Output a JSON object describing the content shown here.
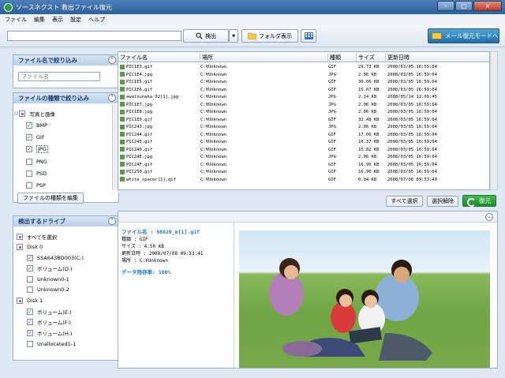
{
  "window": {
    "title": "ソースネクスト 救出ファイル復元",
    "min": "–",
    "max": "□",
    "close": "×"
  },
  "menu": [
    "ファイル",
    "編集",
    "表示",
    "設定",
    "ヘルプ"
  ],
  "toolbar": {
    "search_value": "",
    "search_label": "検出",
    "dropdown": "▼",
    "folder_view_label": "フォルダ表示",
    "mail_mode_label": "メール復元モードへ"
  },
  "filter_name": {
    "title": "ファイル名で絞り込み",
    "placeholder": "ファイル名",
    "toggle": "⌃"
  },
  "filter_type": {
    "title": "ファイルの種類で絞り込み",
    "toggle": "⌃",
    "group_label": "写真と画像",
    "group_expander": "⊟",
    "items": [
      {
        "label": "BMP",
        "checked": true
      },
      {
        "label": "GIF",
        "checked": true
      },
      {
        "label": "JPG",
        "checked": true
      },
      {
        "label": "PNG",
        "checked": false
      },
      {
        "label": "PSD",
        "checked": false
      },
      {
        "label": "PSP",
        "checked": false
      }
    ],
    "edit_button": "ファイルの種類を編集"
  },
  "drives": {
    "title": "検出するドライブ",
    "toggle": "⌃",
    "select_all": "すべてを選択",
    "disks": [
      {
        "label": "Disk 0",
        "volumes": [
          {
            "label": "SSA643BD003(C:)",
            "checked": true
          },
          {
            "label": "ボリューム(D:)",
            "checked": true
          },
          {
            "label": "Unknown0-1",
            "checked": false
          },
          {
            "label": "Unknown0-2",
            "checked": false
          }
        ]
      },
      {
        "label": "Disk 1",
        "volumes": [
          {
            "label": "ボリューム(E:)",
            "checked": true
          },
          {
            "label": "ボリューム(F:)",
            "checked": true
          },
          {
            "label": "ボリューム(H:)",
            "checked": true
          },
          {
            "label": "Unallocated1-1",
            "checked": false
          }
        ]
      }
    ]
  },
  "grid": {
    "columns": [
      "ファイル名",
      "場所",
      "種類",
      "サイズ",
      "更新日時"
    ],
    "rows": [
      [
        "PIC1E3.gif",
        "C:¥Unknown",
        "GIF",
        "29.73 KB",
        "2008/03/05 16:59:04"
      ],
      [
        "PIC1E4.jpg",
        "C:¥Unknown",
        "JPG",
        "2.06 KB",
        "2008/03/05 16:59:04"
      ],
      [
        "PIC1E5.gif",
        "C:¥Unknown",
        "GIF",
        "30.06 KB",
        "2008/03/05 16:59:04"
      ],
      [
        "PIC1E6.gif",
        "C:¥Unknown",
        "GIF",
        "15.07 KB",
        "2008/03/05 16:59:04"
      ],
      [
        "awatsunaka_02[1].jpg",
        "C:¥Unknown",
        "JPG",
        "2.14 KB",
        "2008/05/14 12:09:45"
      ],
      [
        "PIC1E7.jpg",
        "C:¥Unknown",
        "JPG",
        "2.06 KB",
        "2008/03/05 16:59:04"
      ],
      [
        "PIC1E8.jpg",
        "C:¥Unknown",
        "JPG",
        "2.06 KB",
        "2008/03/05 16:59:04"
      ],
      [
        "PIC1E9.gif",
        "C:¥Unknown",
        "GIF",
        "32.48 KB",
        "2008/03/05 16:59:04"
      ],
      [
        "PIC243.jpg",
        "C:¥Unknown",
        "JPG",
        "2.06 KB",
        "2008/03/05 16:59:04"
      ],
      [
        "PIC244.gif",
        "C:¥Unknown",
        "GIF",
        "17.06 KB",
        "2008/03/05 16:59:04"
      ],
      [
        "PIC245.gif",
        "C:¥Unknown",
        "GIF",
        "16.37 KB",
        "2008/03/05 16:59:04"
      ],
      [
        "PIC246.gif",
        "C:¥Unknown",
        "GIF",
        "15.82 KB",
        "2008/03/05 16:59:04"
      ],
      [
        "PIC24E.jpg",
        "C:¥Unknown",
        "JPG",
        "2.06 KB",
        "2008/03/05 16:59:04"
      ],
      [
        "PIC24F.gif",
        "C:¥Unknown",
        "GIF",
        "16.90 KB",
        "2008/03/05 16:59:04"
      ],
      [
        "PIC250.gif",
        "C:¥Unknown",
        "GIF",
        "16.90 KB",
        "2008/03/05 16:59:04"
      ],
      [
        "white_spacer[1].gif",
        "C:¥Unknown",
        "GIF",
        "0.04 KB",
        "2008/07/08 09:53:40"
      ]
    ]
  },
  "actions": {
    "select_all": "すべて選択",
    "deselect": "選択解除",
    "restore": "復元"
  },
  "preview": {
    "toggle": "⌄",
    "filename_line": "ファイル名 : 98620_m[1].gif",
    "type_line": "種類 : GIF",
    "size_line": "サイズ  : 4.50 KB",
    "modified_line": "更新日時 : 2008/07/08 09:53:41",
    "location_line": "場所   : C:¥Unknown",
    "ratio_line": "データ残存率: 100%"
  },
  "colors": {
    "accent": "#2f5f9c",
    "restore": "#1a8a2c",
    "info": "#1a7ac4"
  }
}
